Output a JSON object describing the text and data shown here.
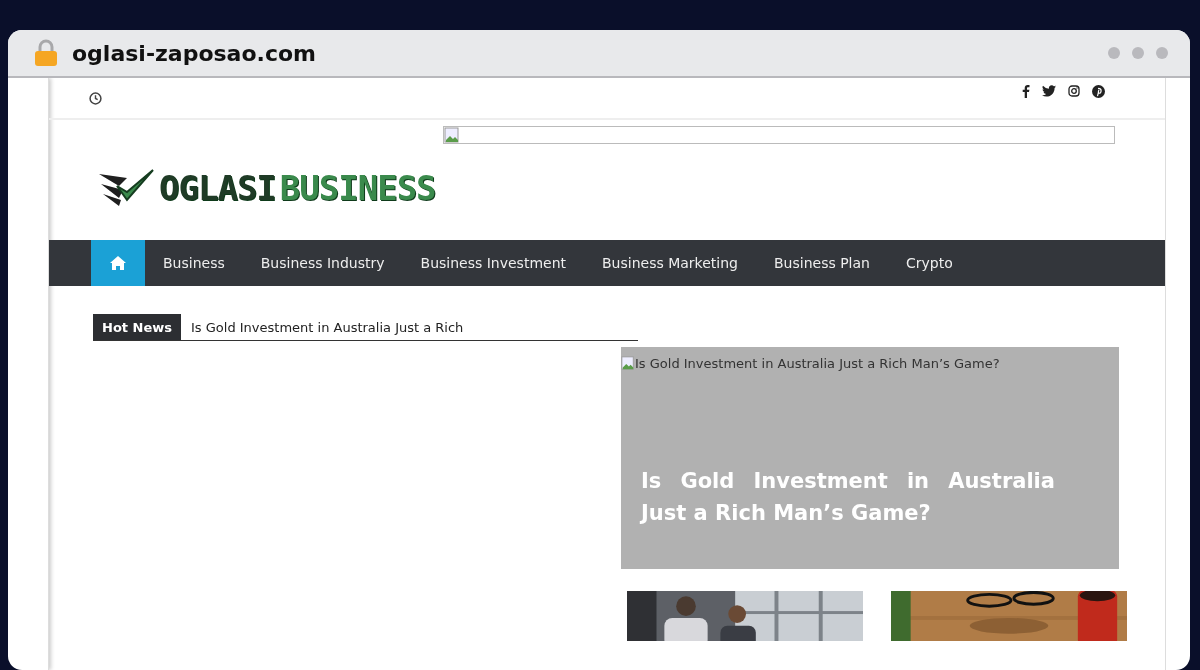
{
  "browser": {
    "address": "oglasi-zaposao.com"
  },
  "top_bar": {
    "social": [
      {
        "kind": "facebook"
      },
      {
        "kind": "twitter"
      },
      {
        "kind": "instagram"
      },
      {
        "kind": "pinterest"
      }
    ]
  },
  "logo": {
    "part_1": "OGLASI",
    "part_2": "BUSINESS"
  },
  "nav": {
    "items": [
      {
        "kind": "home",
        "selected": true
      },
      {
        "kind": "link",
        "label": "Business",
        "selected": false
      },
      {
        "kind": "link",
        "label": "Business Industry",
        "selected": false
      },
      {
        "kind": "link",
        "label": "Business Investment",
        "selected": false
      },
      {
        "kind": "link",
        "label": "Business Marketing",
        "selected": false
      },
      {
        "kind": "link",
        "label": "Business Plan",
        "selected": false
      },
      {
        "kind": "link",
        "label": "Crypto",
        "selected": false
      }
    ]
  },
  "hot_news": {
    "label": "Hot News",
    "headline": "Is Gold Investment in Australia Just a Rich"
  },
  "featured": {
    "image_alt": "Is Gold Investment in Australia Just a Rich Man’s Game?",
    "title": "Is Gold Investment in Australia Just a Rich Man’s Game?"
  }
}
